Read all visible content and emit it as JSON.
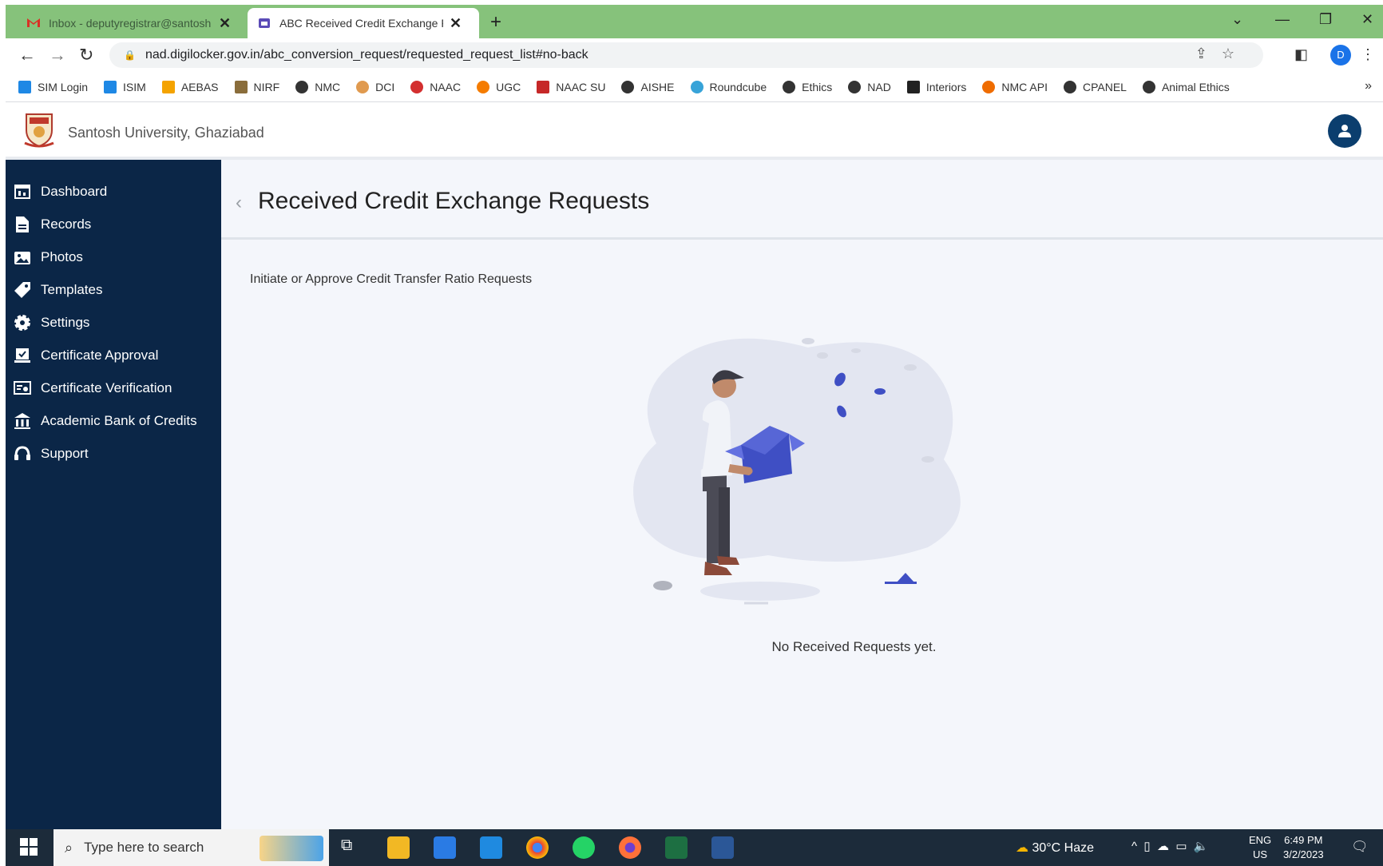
{
  "browser": {
    "tabs": [
      {
        "title": "Inbox - deputyregistrar@santosh",
        "active": false
      },
      {
        "title": "ABC Received Credit Exchange Re",
        "active": true
      }
    ],
    "url": "nad.digilocker.gov.in/abc_conversion_request/requested_request_list#no-back",
    "profile_initial": "D",
    "bookmarks": [
      {
        "label": "SIM Login",
        "icon": "sim-login-icon",
        "color": "#1e88e5"
      },
      {
        "label": "ISIM",
        "icon": "isim-icon",
        "color": "#1e88e5"
      },
      {
        "label": "AEBAS",
        "icon": "aebas-icon",
        "color": "#f4a300"
      },
      {
        "label": "NIRF",
        "icon": "nirf-icon",
        "color": "#8a6d3b"
      },
      {
        "label": "NMC",
        "icon": "globe-icon",
        "color": "#333333"
      },
      {
        "label": "DCI",
        "icon": "dci-icon",
        "color": "#e09a4f"
      },
      {
        "label": "NAAC",
        "icon": "naac-icon",
        "color": "#d32f2f"
      },
      {
        "label": "UGC",
        "icon": "ugc-icon",
        "color": "#f57c00"
      },
      {
        "label": "NAAC SU",
        "icon": "naac-su-icon",
        "color": "#c62828"
      },
      {
        "label": "AISHE",
        "icon": "globe-icon",
        "color": "#333333"
      },
      {
        "label": "Roundcube",
        "icon": "roundcube-icon",
        "color": "#37a3d8"
      },
      {
        "label": "Ethics",
        "icon": "globe-icon",
        "color": "#333333"
      },
      {
        "label": "NAD",
        "icon": "globe-icon",
        "color": "#333333"
      },
      {
        "label": "Interiors",
        "icon": "interiors-icon",
        "color": "#222222"
      },
      {
        "label": "NMC API",
        "icon": "nmc-api-icon",
        "color": "#ef6c00"
      },
      {
        "label": "CPANEL",
        "icon": "globe-icon",
        "color": "#333333"
      },
      {
        "label": "Animal Ethics",
        "icon": "globe-icon",
        "color": "#333333"
      }
    ]
  },
  "header": {
    "university_name": "Santosh University, Ghaziabad"
  },
  "sidebar": {
    "items": [
      {
        "label": "Dashboard",
        "icon": "dashboard-icon"
      },
      {
        "label": "Records",
        "icon": "records-icon"
      },
      {
        "label": "Photos",
        "icon": "photos-icon"
      },
      {
        "label": "Templates",
        "icon": "templates-icon"
      },
      {
        "label": "Settings",
        "icon": "settings-icon"
      },
      {
        "label": "Certificate Approval",
        "icon": "certificate-approval-icon"
      },
      {
        "label": "Certificate Verification",
        "icon": "certificate-verification-icon"
      },
      {
        "label": "Academic Bank of Credits",
        "icon": "bank-icon"
      },
      {
        "label": "Support",
        "icon": "support-icon"
      }
    ]
  },
  "main": {
    "title": "Received Credit Exchange Requests",
    "subtitle": "Initiate or Approve Credit Transfer Ratio Requests",
    "empty_message": "No Received Requests yet."
  },
  "taskbar": {
    "search_placeholder": "Type here to search",
    "weather": "30°C  Haze",
    "lang_top": "ENG",
    "lang_bottom": "US",
    "time": "6:49 PM",
    "date": "3/2/2023"
  },
  "colors": {
    "tab_strip": "#86c27b",
    "sidebar_bg": "#0b2647",
    "main_bg": "#f4f6fb",
    "accent": "#0b3e6e",
    "illustration_blue": "#3f4fc4"
  }
}
